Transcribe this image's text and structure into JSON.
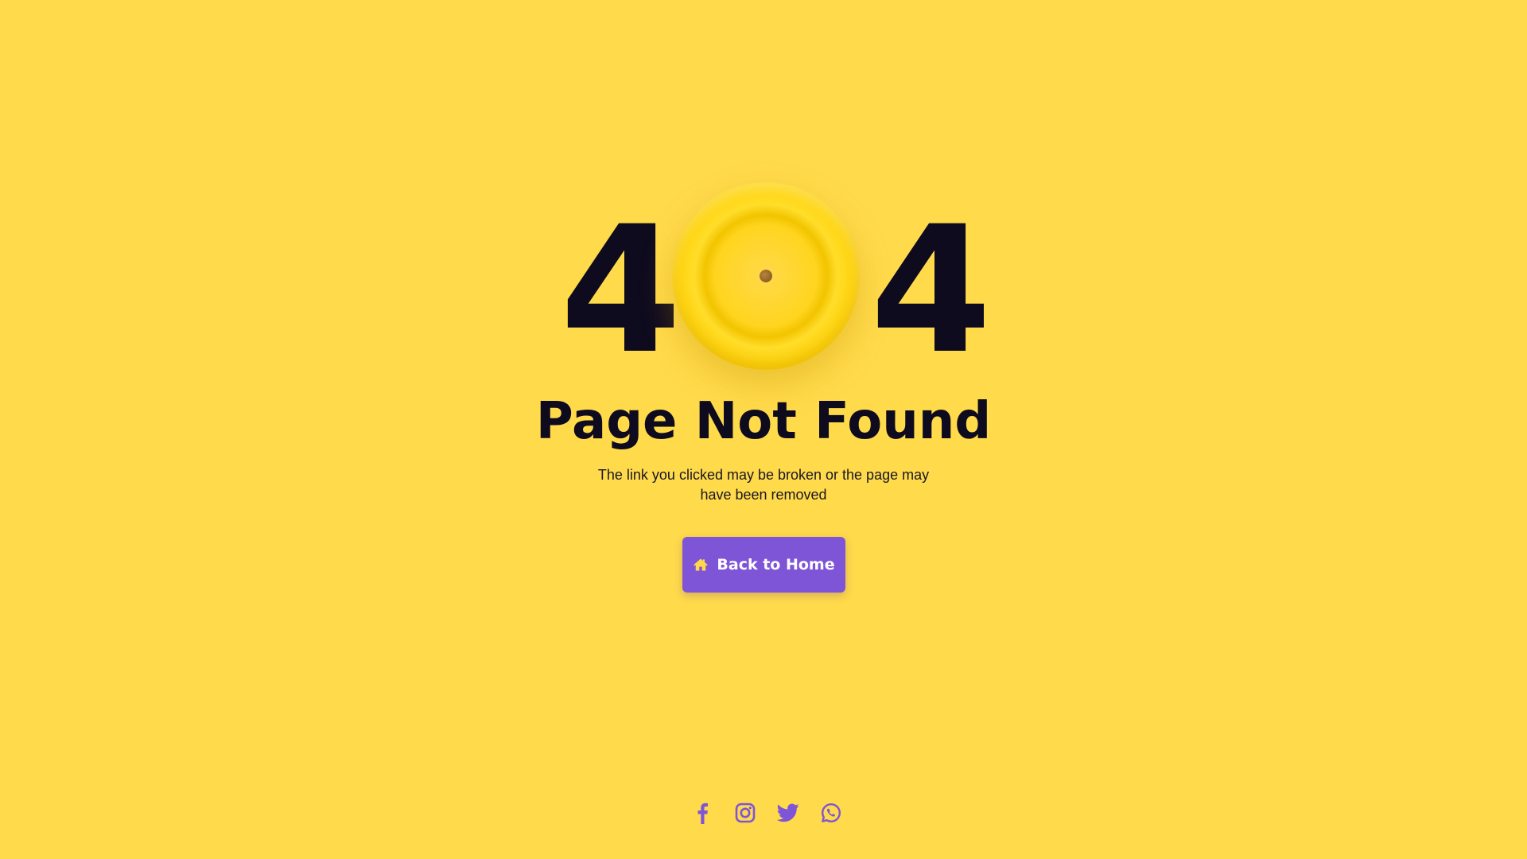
{
  "colors": {
    "background": "#FFDA4A",
    "text_dark": "#0F0B1F",
    "accent": "#7F55D8",
    "button_icon": "#FFD84A"
  },
  "hero": {
    "digit_left": "4",
    "digit_right": "4",
    "center_graphic": "yellow-ball-zero"
  },
  "title": "Page Not Found",
  "subtitle": "The link you clicked may be broken or the page may have been removed",
  "button": {
    "label": "Back to Home",
    "icon": "home-icon"
  },
  "social": [
    {
      "name": "facebook-icon"
    },
    {
      "name": "instagram-icon"
    },
    {
      "name": "twitter-icon"
    },
    {
      "name": "whatsapp-icon"
    }
  ]
}
